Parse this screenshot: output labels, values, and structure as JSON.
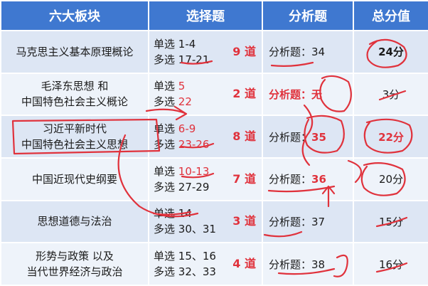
{
  "header": {
    "col_module": "六大板块",
    "col_choice": "选择题",
    "col_analysis": "分析题",
    "col_total": "总分值"
  },
  "rows": [
    {
      "subject": [
        "马克思主义基本原理概论"
      ],
      "single_label": "单选",
      "single_range": "1-4",
      "multi_label": "多选",
      "multi_range": "17-21",
      "count": "9 道",
      "analysis_label": "分析题：",
      "analysis_value": "34",
      "total": "24分"
    },
    {
      "subject": [
        "毛泽东思想 和",
        "中国特色社会主义概论"
      ],
      "single_label": "单选",
      "single_range": "5",
      "multi_label": "多选",
      "multi_range": "22",
      "count": "2 道",
      "analysis_label": "分析题：",
      "analysis_value": "无",
      "total": "3分"
    },
    {
      "subject": [
        "习近平新时代",
        "中国特色社会主义思想"
      ],
      "single_label": "单选",
      "single_range": "6-9",
      "multi_label": "多选",
      "multi_range": "23-26",
      "count": "8 道",
      "analysis_label": "分析题：",
      "analysis_value": "35",
      "total": "22分"
    },
    {
      "subject": [
        "中国近现代史纲要"
      ],
      "single_label": "单选",
      "single_range": "10-13",
      "multi_label": "多选",
      "multi_range": "27-29",
      "count": "7 道",
      "analysis_label": "分析题：",
      "analysis_value": "36",
      "total": "20分"
    },
    {
      "subject": [
        "思想道德与法治"
      ],
      "single_label": "单选",
      "single_range": "14",
      "multi_label": "多选",
      "multi_range": "30、31",
      "count": "3 道",
      "analysis_label": "分析题：",
      "analysis_value": "37",
      "total": "15分"
    },
    {
      "subject": [
        "形势与政策 以及",
        "当代世界经济与政治"
      ],
      "single_label": "单选",
      "single_range": "15、16",
      "multi_label": "多选",
      "multi_range": "32、33",
      "count": "4 道",
      "analysis_label": "分析题：",
      "analysis_value": "38",
      "total": "16分"
    }
  ],
  "colors": {
    "header_bg": "#3f78d0",
    "row_dark": "#dde6f4",
    "row_light": "#eef3fa",
    "highlight_red": "#e0323c",
    "text": "#1b1b1b"
  }
}
